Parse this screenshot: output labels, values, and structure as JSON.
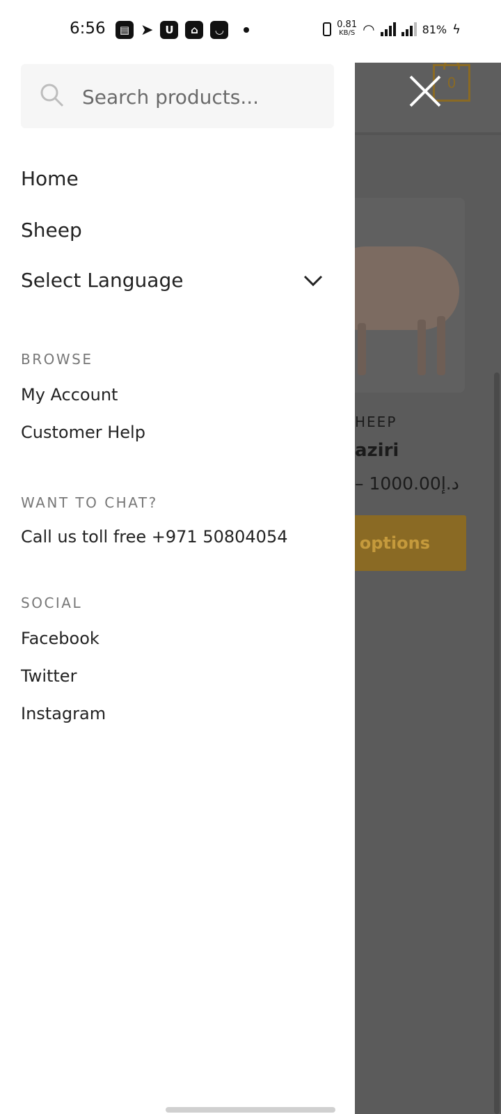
{
  "status_bar": {
    "time": "6:56",
    "speed_value": "0.81",
    "speed_unit": "KB/S",
    "battery": "81%",
    "icons": [
      "news-icon",
      "telegram-icon",
      "u-app-icon",
      "mosque-app-icon",
      "smile-app-icon",
      "notification-dot-icon",
      "vibrate-icon",
      "wifi-icon",
      "signal-icon",
      "signal-icon",
      "charging-icon"
    ]
  },
  "search": {
    "placeholder": "Search products..."
  },
  "menu": {
    "items": [
      {
        "label": "Home"
      },
      {
        "label": "Sheep"
      }
    ],
    "language_label": "Select Language"
  },
  "sections": [
    {
      "heading": "BROWSE",
      "links": [
        "My Account",
        "Customer Help"
      ]
    },
    {
      "heading": "WANT TO CHAT?",
      "links": [
        "Call us toll free +971 50804054"
      ]
    },
    {
      "heading": "SOCIAL",
      "links": [
        "Facebook",
        "Twitter",
        "Instagram"
      ]
    }
  ],
  "background_page": {
    "cart_count": "0",
    "category": "HEEP",
    "product_name": "aziri",
    "price": "– 1000.00د.إ",
    "button_label": "t options"
  },
  "colors": {
    "accent": "#8a6a24",
    "overlay": "#5b5b5b",
    "drawer_bg": "#ffffff"
  }
}
